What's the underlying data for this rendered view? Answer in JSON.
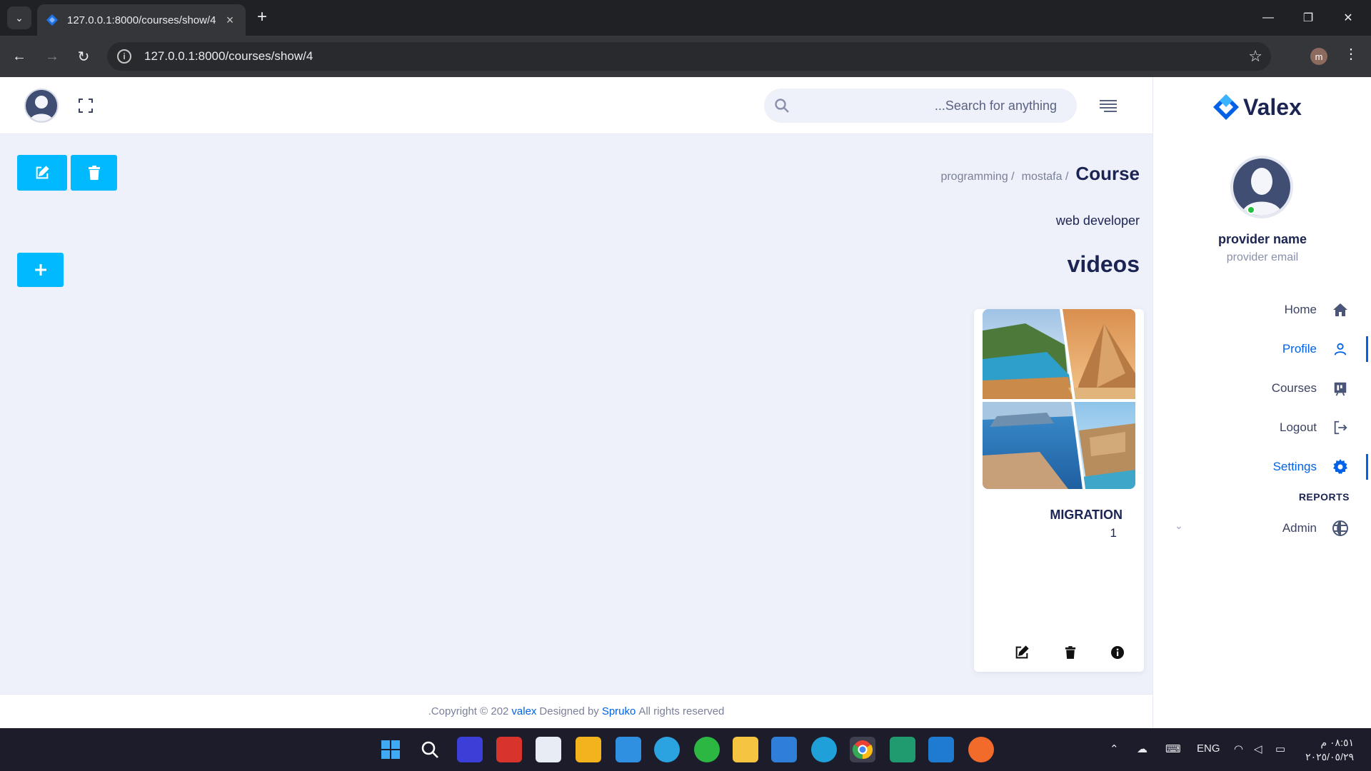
{
  "browser": {
    "tab_title": "127.0.0.1:8000/courses/show/4",
    "url": "127.0.0.1:8000/courses/show/4",
    "profile_initial": "m"
  },
  "header": {
    "search_placeholder": "...Search for anything"
  },
  "sidebar": {
    "brand": "Valex",
    "provider_name": "provider name",
    "provider_email": "provider email",
    "items": [
      {
        "label": "Home",
        "icon": "home-icon"
      },
      {
        "label": "Profile",
        "icon": "user-icon",
        "active": true
      },
      {
        "label": "Courses",
        "icon": "courses-icon"
      },
      {
        "label": "Logout",
        "icon": "logout-icon"
      },
      {
        "label": "Settings",
        "icon": "gear-icon",
        "active": true
      }
    ],
    "section_label": "REPORTS",
    "admin_label": "Admin"
  },
  "breadcrumb": {
    "items": [
      "programming /",
      "mostafa /"
    ],
    "current": "Course"
  },
  "course": {
    "subtitle": "web developer",
    "section_title": "videos"
  },
  "card": {
    "title": "MIGRATION",
    "count": "1"
  },
  "footer": {
    "prefix": ".Copyright © 202",
    "brand": "valex",
    "middle": "Designed by",
    "author": "Spruko",
    "suffix": "All rights reserved"
  },
  "taskbar": {
    "lang": "ENG",
    "time": "٠٨:٥١ م",
    "date": "٢٠٢٥/٠٥/٢٩"
  },
  "colors": {
    "accent": "#00b9ff",
    "brand_blue": "#0162e8",
    "online": "#22c03c"
  }
}
